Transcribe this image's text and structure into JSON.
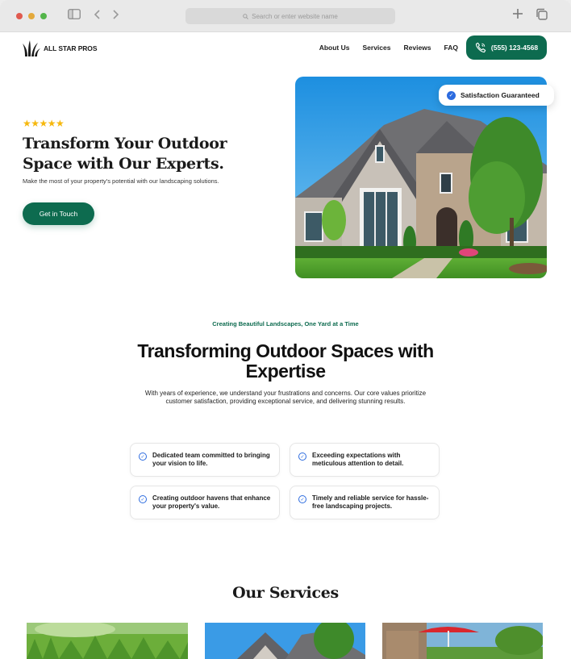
{
  "browser": {
    "address_placeholder": "Search or enter website name"
  },
  "brand": {
    "name": "ALL STAR PROS"
  },
  "nav": {
    "links": [
      "About Us",
      "Services",
      "Reviews",
      "FAQ"
    ],
    "phone": "(555) 123-4568"
  },
  "hero": {
    "rating": 5,
    "title": "Transform Your Outdoor Space with Our Experts.",
    "subtitle": "Make the most of your property's potential with our landscaping solutions.",
    "cta": "Get in Touch",
    "badge": "Satisfaction Guaranteed"
  },
  "about": {
    "eyebrow": "Creating Beautiful Landscapes, One Yard at a Time",
    "title": "Transforming Outdoor Spaces with Expertise",
    "description": "With years of experience, we understand your frustrations and concerns. Our core values prioritize customer satisfaction, providing exceptional service, and delivering stunning results.",
    "features": [
      "Dedicated team committed to bringing your vision to life.",
      "Exceeding expectations with meticulous attention to detail.",
      "Creating outdoor havens that enhance your property's value.",
      "Timely and reliable service for hassle-free landscaping projects."
    ]
  },
  "services": {
    "title": "Our Services"
  },
  "colors": {
    "primary": "#0d6b4f",
    "star": "#f6b80e",
    "check": "#2c6bdf"
  }
}
